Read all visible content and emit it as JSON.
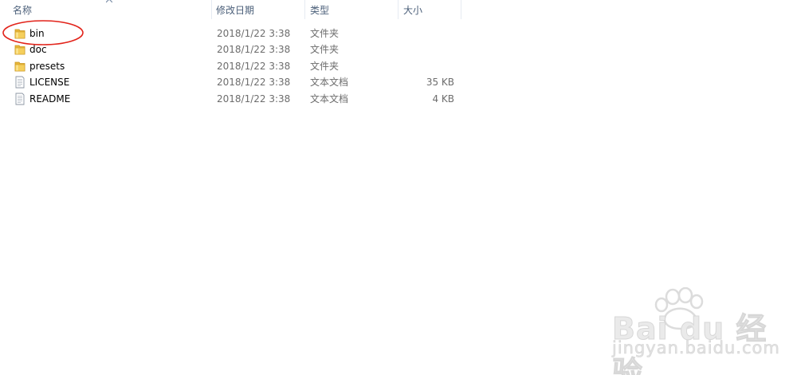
{
  "columns": {
    "name": "名称",
    "date": "修改日期",
    "type": "类型",
    "size": "大小"
  },
  "files": [
    {
      "name": "bin",
      "date": "2018/1/22 3:38",
      "type": "文件夹",
      "size": "",
      "icon": "folder-icon"
    },
    {
      "name": "doc",
      "date": "2018/1/22 3:38",
      "type": "文件夹",
      "size": "",
      "icon": "folder-icon"
    },
    {
      "name": "presets",
      "date": "2018/1/22 3:38",
      "type": "文件夹",
      "size": "",
      "icon": "folder-icon"
    },
    {
      "name": "LICENSE",
      "date": "2018/1/22 3:38",
      "type": "文本文档",
      "size": "35 KB",
      "icon": "text-file-icon"
    },
    {
      "name": "README",
      "date": "2018/1/22 3:38",
      "type": "文本文档",
      "size": "4 KB",
      "icon": "text-file-icon"
    }
  ],
  "watermark": {
    "brand": "Bai du 经验",
    "url": "jingyan.baidu.com"
  },
  "colors": {
    "header_text": "#4c607a",
    "folder": "#e8b73a",
    "annotation": "#e2231a",
    "watermark": "#d7d7d7"
  }
}
